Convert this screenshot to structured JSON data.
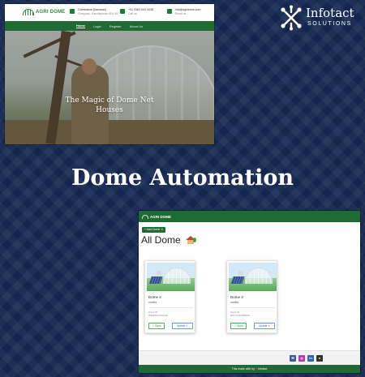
{
  "site_preview": {
    "logo_text": "AGRI DOME",
    "contacts": [
      {
        "icon": "map-pin-icon",
        "line1": "Coimbatore (Ilamaran)",
        "line2": "Cheyyaar, Kanchipuram 604 407"
      },
      {
        "icon": "phone-icon",
        "line1": "+91 9363 9XX 0038",
        "line2": "Call us"
      },
      {
        "icon": "mail-icon",
        "line1": "info@agridome.com",
        "line2": "Email us"
      }
    ],
    "nav": [
      "Home",
      "Login",
      "Register",
      "About Us"
    ],
    "active_nav": "Home",
    "hero_title_line1": "The Magic of Dome Net",
    "hero_title_line2": "Houses"
  },
  "brand": {
    "name": "Infotact",
    "tagline": "SOLUTIONS"
  },
  "heading": "Dome Automation",
  "app_preview": {
    "logo_text": "AGRI DOME",
    "add_button": "+ Add Dome ✕",
    "page_title": "All Dome",
    "cards": [
      {
        "name": "Dome 2",
        "subtitle": "vanilla",
        "meta1": "Dome ID",
        "meta2": "8f3a2b91c7d04e6a",
        "open": "↗ Open",
        "update": "Update ✕"
      },
      {
        "name": "Dome 3",
        "subtitle": "vanilla",
        "meta1": "Dome ID",
        "meta2": "9b1c7e42d05f8a3c",
        "open": "↗ Open",
        "update": "Update ✕"
      }
    ],
    "social": [
      {
        "icon": "mail-icon",
        "label": "✉",
        "color": "#3b5c9e"
      },
      {
        "icon": "instagram-icon",
        "label": "◎",
        "color": "#b03aa8"
      },
      {
        "icon": "linkedin-icon",
        "label": "in",
        "color": "#2a67b0"
      },
      {
        "icon": "github-icon",
        "label": "●",
        "color": "#333333"
      }
    ],
    "footer_text": "This made with by ",
    "footer_brand": "Infotact"
  },
  "colors": {
    "background": "#14264e",
    "brand_green": "#1f6b33"
  }
}
